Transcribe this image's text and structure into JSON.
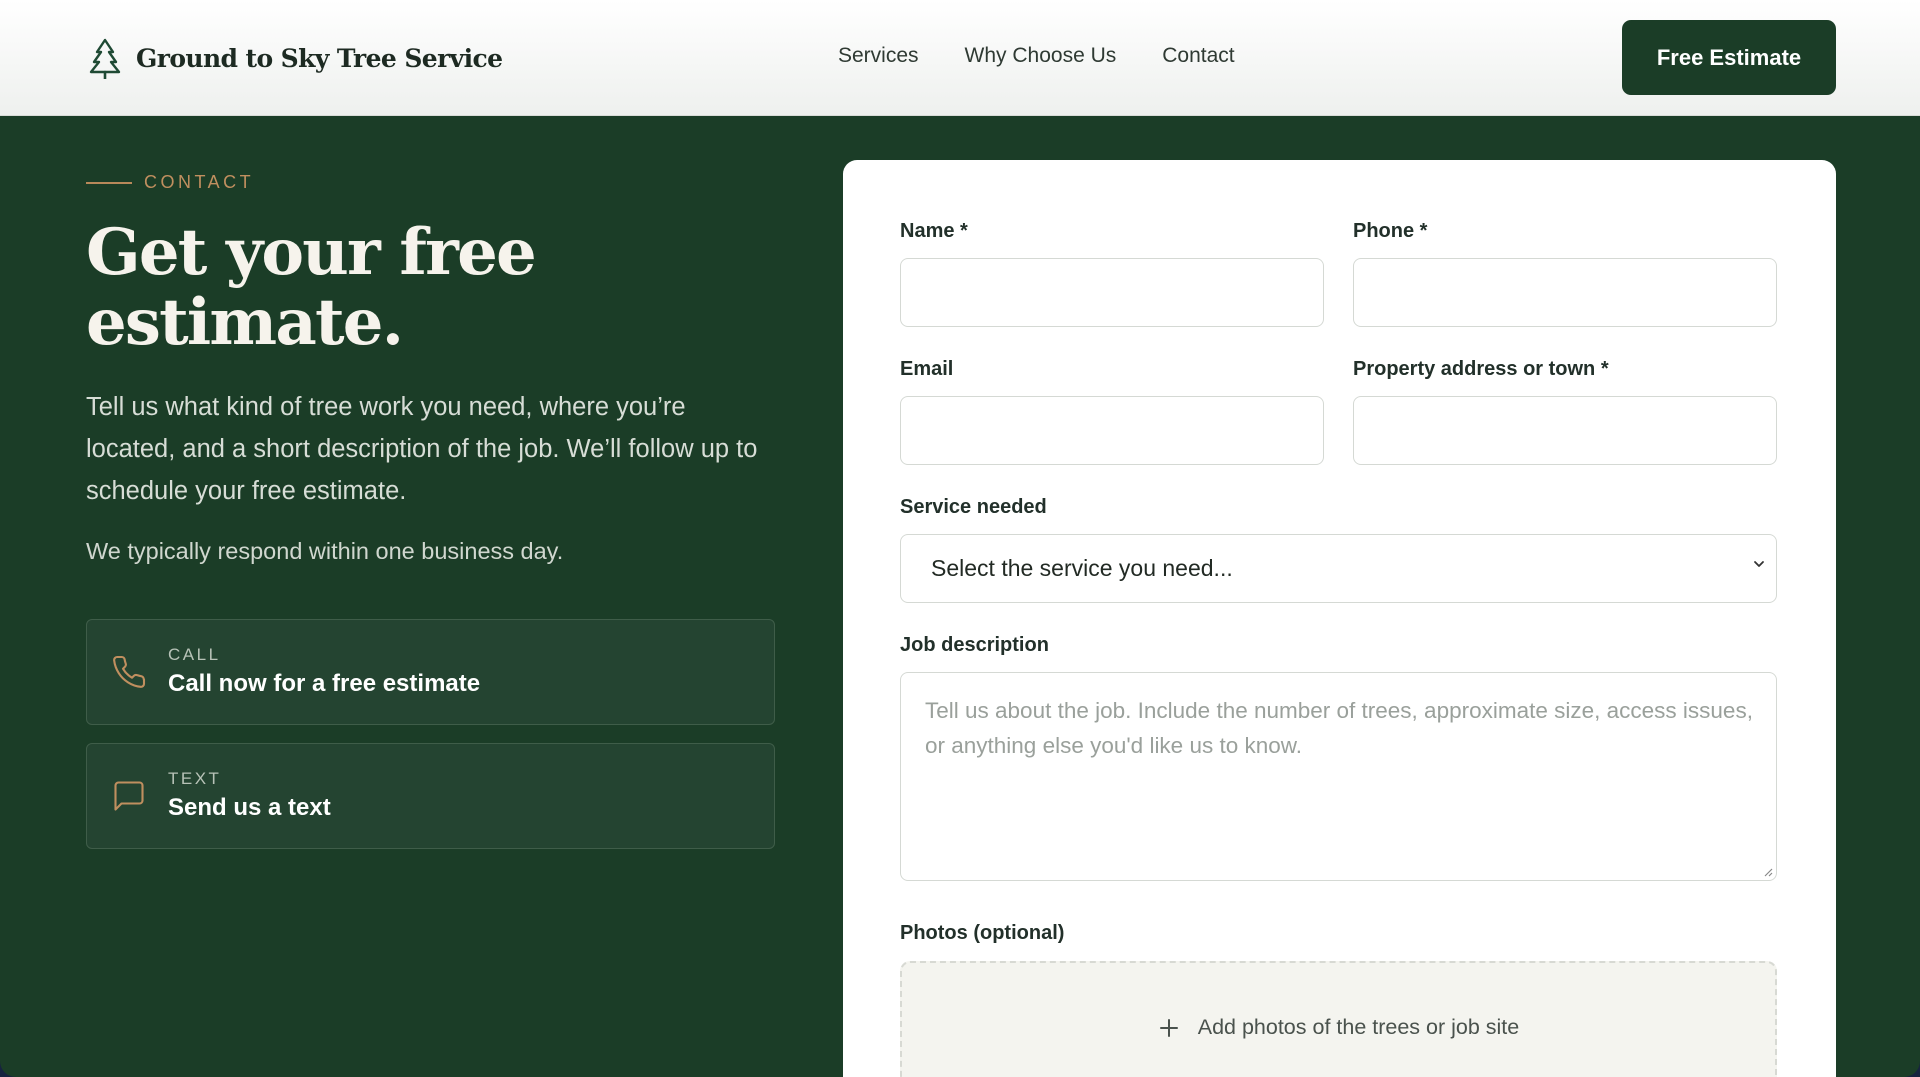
{
  "header": {
    "brand_name": "Ground to Sky Tree Service",
    "nav": [
      "Services",
      "Why Choose Us",
      "Contact"
    ],
    "cta_label": "Free Estimate"
  },
  "contact_section": {
    "eyebrow": "CONTACT",
    "headline_line1": "Get your free",
    "headline_line2": "estimate.",
    "intro": "Tell us what kind of tree work you need, where you’re located, and a short description of the job. We’ll follow up to schedule your free estimate.",
    "response_note": "We typically respond within one business day.",
    "cards": [
      {
        "label": "CALL",
        "title": "Call now for a free estimate",
        "icon": "phone-icon"
      },
      {
        "label": "TEXT",
        "title": "Send us a text",
        "icon": "message-icon"
      }
    ]
  },
  "form": {
    "name_label": "Name *",
    "phone_label": "Phone *",
    "email_label": "Email",
    "address_label": "Property address or town *",
    "service_label": "Service needed",
    "service_selected": "Select the service you need...",
    "job_label": "Job description",
    "job_placeholder": "Tell us about the job. Include the number of trees, approximate size, access issues, or anything else you'd like us to know.",
    "photos_label": "Photos (optional)",
    "photos_cta": "Add photos of the trees or job site"
  },
  "colors": {
    "forest_green": "#1b3d27",
    "accent_tan": "#c08f5f",
    "card_green": "#244431"
  }
}
